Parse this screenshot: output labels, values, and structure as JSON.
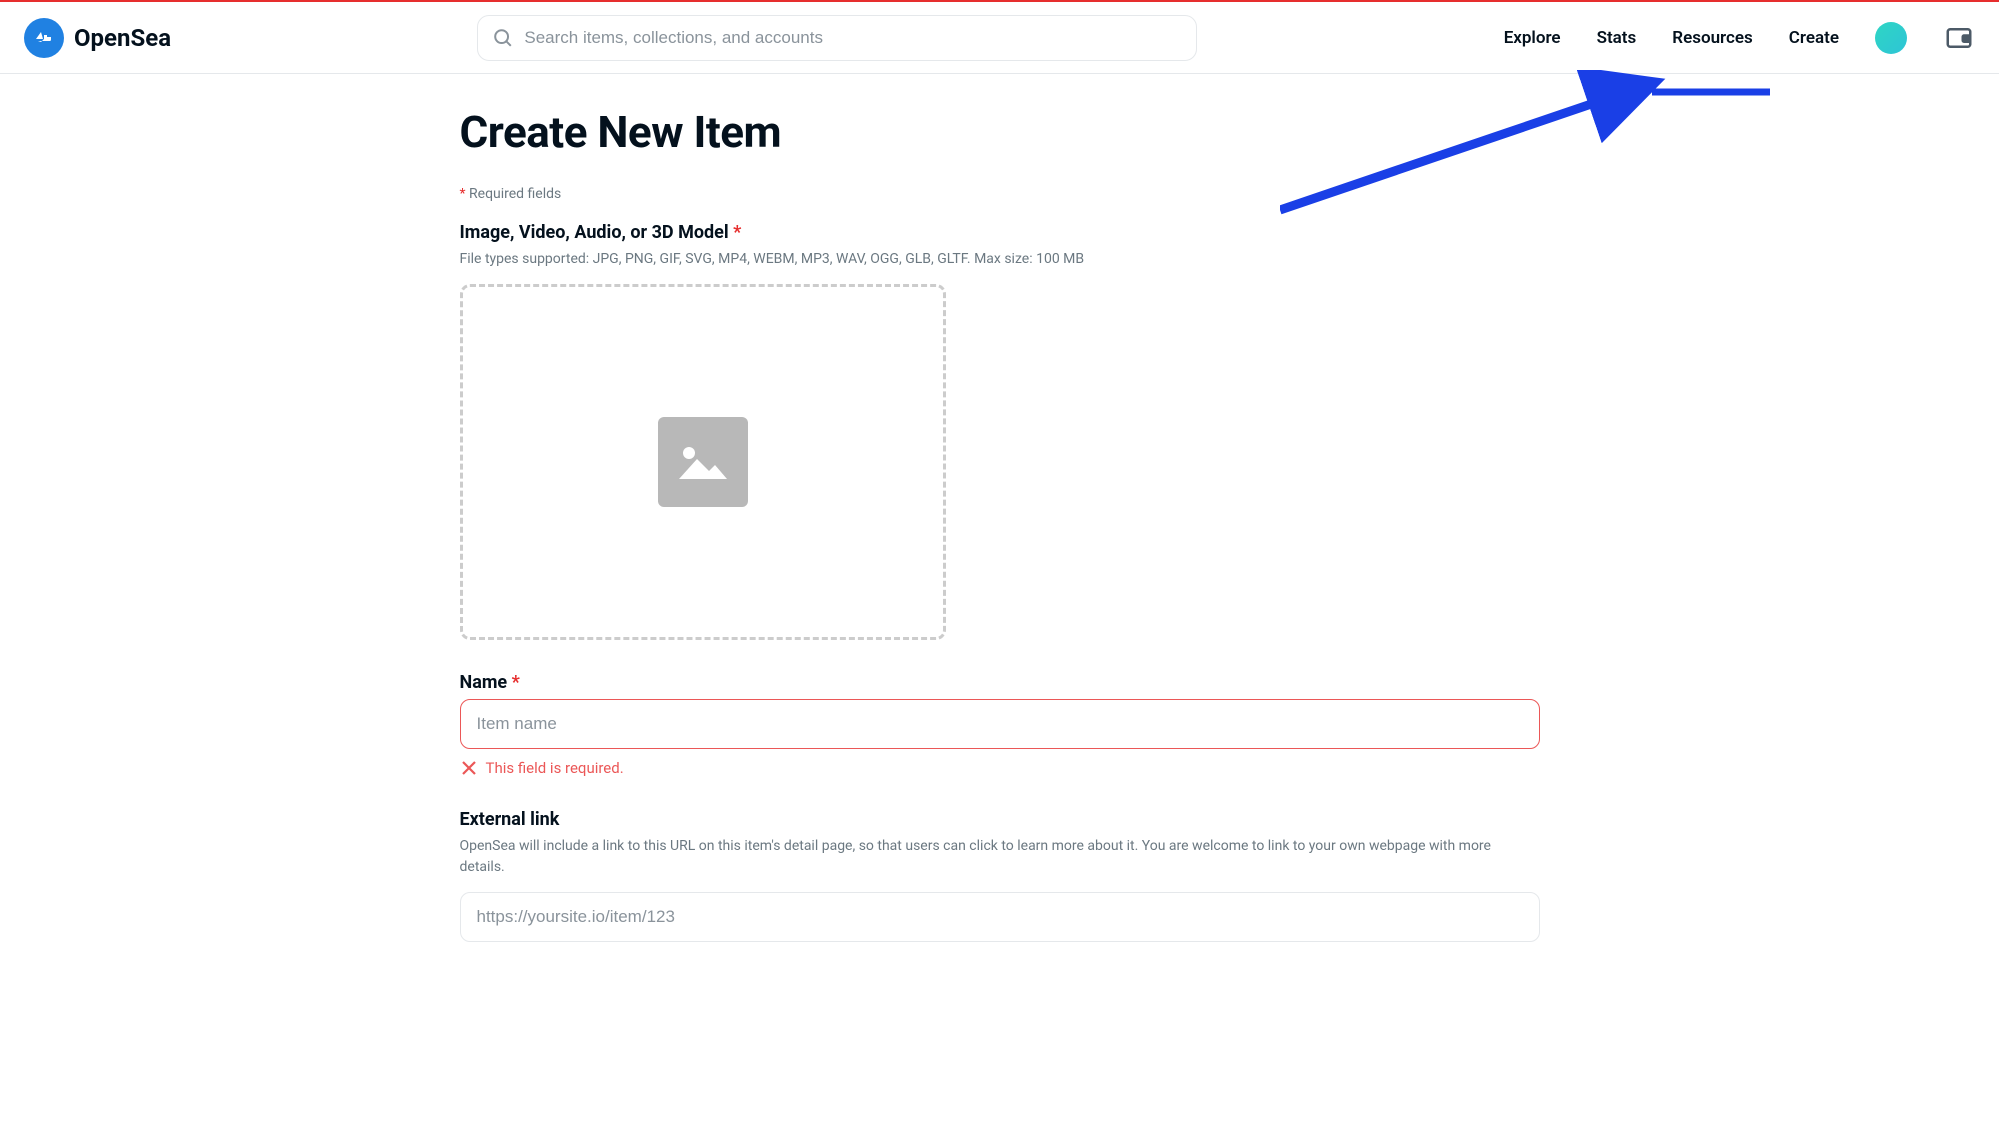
{
  "brand": {
    "name": "OpenSea"
  },
  "search": {
    "placeholder": "Search items, collections, and accounts"
  },
  "nav": {
    "explore": "Explore",
    "stats": "Stats",
    "resources": "Resources",
    "create": "Create"
  },
  "page": {
    "title": "Create New Item",
    "required_note": "Required fields"
  },
  "fields": {
    "media": {
      "label": "Image, Video, Audio, or 3D Model",
      "help": "File types supported: JPG, PNG, GIF, SVG, MP4, WEBM, MP3, WAV, OGG, GLB, GLTF. Max size: 100 MB"
    },
    "name": {
      "label": "Name",
      "placeholder": "Item name",
      "error": "This field is required."
    },
    "external": {
      "label": "External link",
      "help": "OpenSea will include a link to this URL on this item's detail page, so that users can click to learn more about it. You are welcome to link to your own webpage with more details.",
      "placeholder": "https://yoursite.io/item/123"
    }
  }
}
